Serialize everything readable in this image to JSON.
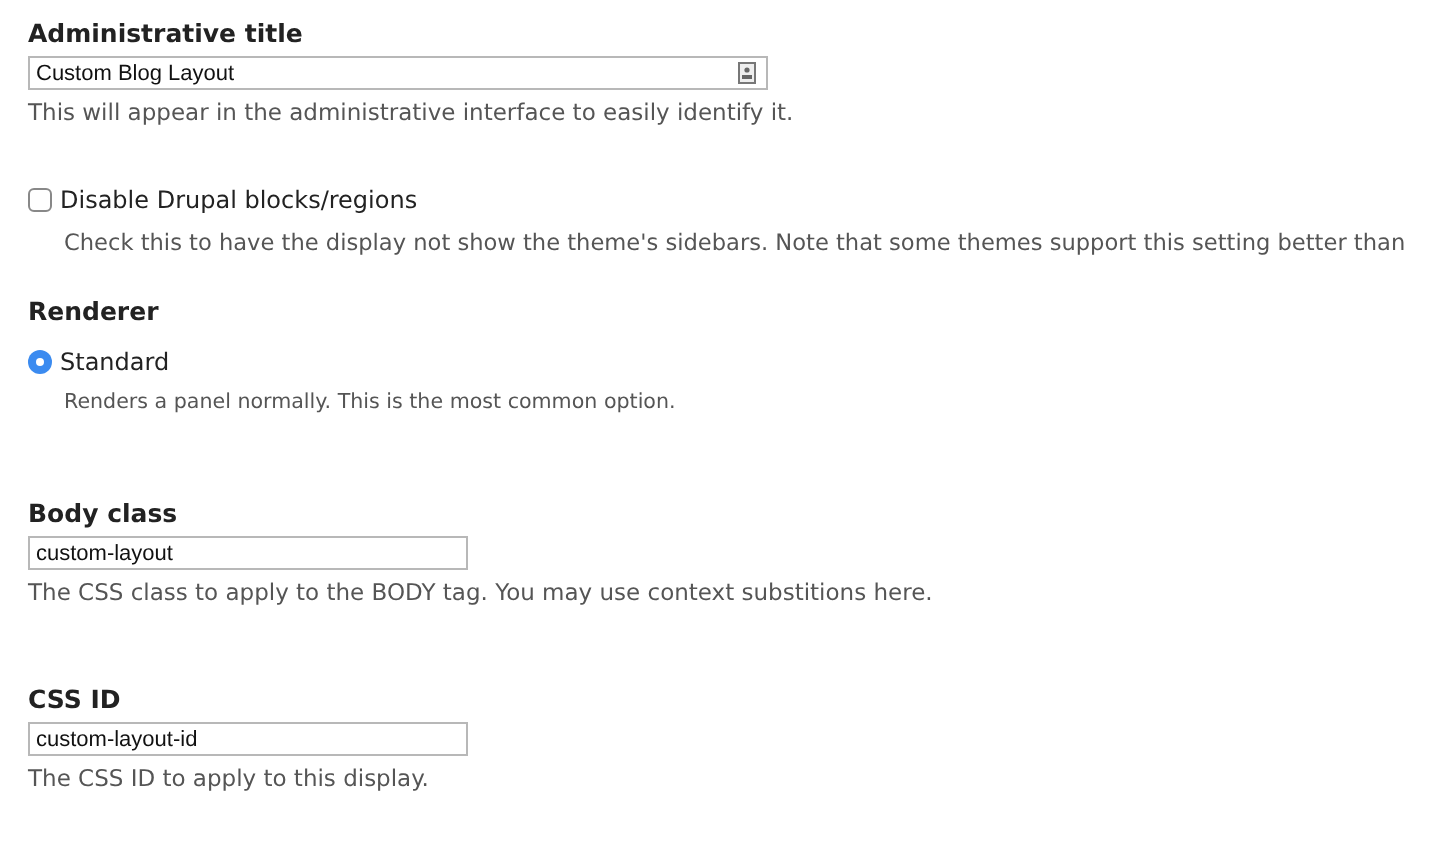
{
  "administrative_title": {
    "label": "Administrative title",
    "value": "Custom Blog Layout",
    "description": "This will appear in the administrative interface to easily identify it."
  },
  "disable_blocks": {
    "label": "Disable Drupal blocks/regions",
    "checked": false,
    "description": "Check this to have the display not show the theme's sidebars. Note that some themes support this setting better than"
  },
  "renderer": {
    "label": "Renderer",
    "options": [
      {
        "label": "Standard",
        "selected": true,
        "description": "Renders a panel normally. This is the most common option."
      }
    ]
  },
  "body_class": {
    "label": "Body class",
    "value": "custom-layout",
    "description": "The CSS class to apply to the BODY tag. You may use context substitions here."
  },
  "css_id": {
    "label": "CSS ID",
    "value": "custom-layout-id",
    "description": "The CSS ID to apply to this display."
  }
}
